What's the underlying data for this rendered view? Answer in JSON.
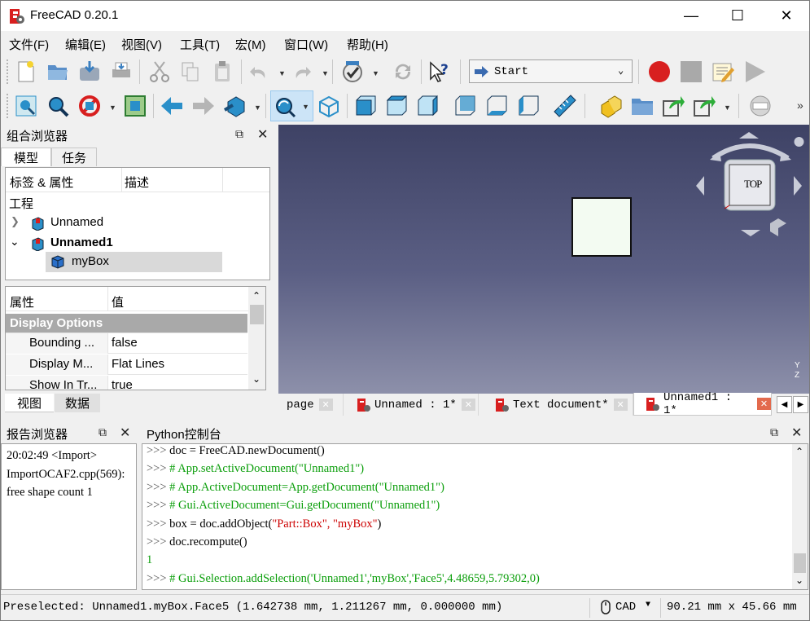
{
  "window": {
    "title": "FreeCAD 0.20.1",
    "minimize": "—",
    "maximize": "☐",
    "close": "✕"
  },
  "menu": [
    "文件(F)",
    "编辑(E)",
    "视图(V)",
    "工具(T)",
    "宏(M)",
    "窗口(W)",
    "帮助(H)"
  ],
  "macro": {
    "workbench_selected": "Start"
  },
  "combo": {
    "title": "组合浏览器",
    "tabs": [
      "模型",
      "任务"
    ],
    "tree_headers": [
      "标签 & 属性",
      "描述"
    ],
    "root": "工程",
    "docs": [
      {
        "label": "Unnamed",
        "expanded": false,
        "bold": false
      },
      {
        "label": "Unnamed1",
        "expanded": true,
        "bold": true
      }
    ],
    "child": "myBox",
    "prop_headers": [
      "属性",
      "值"
    ],
    "group": "Display Options",
    "props": [
      {
        "name": "Bounding ...",
        "value": "false"
      },
      {
        "name": "Display M...",
        "value": "Flat Lines"
      },
      {
        "name": "Show In Tr...",
        "value": "true"
      }
    ],
    "bottom_tabs": [
      "视图",
      "数据"
    ]
  },
  "navcube": {
    "face": "TOP"
  },
  "axes": {
    "y": "Y",
    "z": "Z"
  },
  "doc_tabs": [
    {
      "label": "page",
      "active": false
    },
    {
      "label": "Unnamed : 1*",
      "active": false
    },
    {
      "label": "Text document*",
      "active": false
    },
    {
      "label": "Unnamed1 : 1*",
      "active": true
    }
  ],
  "report": {
    "title": "报告浏览器",
    "lines": [
      "20:02:49  <Import>",
      "ImportOCAF2.cpp(569):",
      "free shape count 1"
    ]
  },
  "python": {
    "title": "Python控制台",
    "lines": [
      {
        "prompt": ">>> ",
        "parts": [
          {
            "t": "doc = FreeCAD.newDocument()",
            "c": ""
          }
        ]
      },
      {
        "prompt": ">>> ",
        "parts": [
          {
            "t": "# App.setActiveDocument(\"Unnamed1\")",
            "c": "cmt"
          }
        ]
      },
      {
        "prompt": ">>> ",
        "parts": [
          {
            "t": "# App.ActiveDocument=App.getDocument(\"Unnamed1\")",
            "c": "cmt"
          }
        ]
      },
      {
        "prompt": ">>> ",
        "parts": [
          {
            "t": "# Gui.ActiveDocument=Gui.getDocument(\"Unnamed1\")",
            "c": "cmt"
          }
        ]
      },
      {
        "prompt": ">>> ",
        "parts": [
          {
            "t": "box = doc.addObject(",
            "c": ""
          },
          {
            "t": "\"Part::Box\", \"myBox\"",
            "c": "str"
          },
          {
            "t": ")",
            "c": ""
          }
        ]
      },
      {
        "prompt": ">>> ",
        "parts": [
          {
            "t": "doc.recompute()",
            "c": ""
          }
        ]
      },
      {
        "prompt": "",
        "parts": [
          {
            "t": "1",
            "c": "num"
          }
        ]
      },
      {
        "prompt": ">>> ",
        "parts": [
          {
            "t": "# Gui.Selection.addSelection('Unnamed1','myBox','Face5',4.48659,5.79302,0)",
            "c": "cmt"
          }
        ]
      }
    ]
  },
  "status": {
    "preselected": "Preselected: Unnamed1.myBox.Face5 (1.642738 mm, 1.211267 mm, 0.000000 mm)",
    "nav_style": "CAD",
    "dimensions": "90.21 mm x 45.66 mm"
  },
  "colors": {
    "accent_red": "#d81f1f",
    "cube_blue": "#2a8fc9",
    "comment_green": "#0a9e0a",
    "string_red": "#cc0000"
  }
}
